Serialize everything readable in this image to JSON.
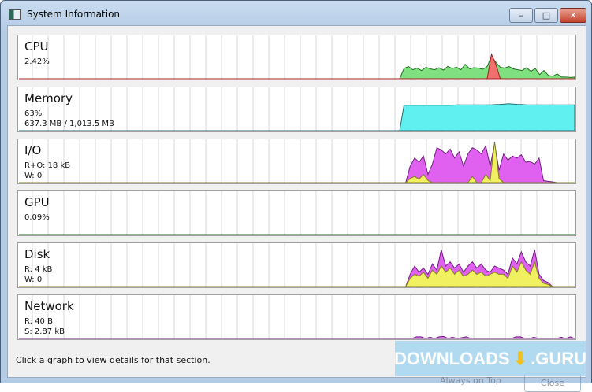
{
  "window": {
    "title": "System Information",
    "minimize": "–",
    "maximize": "□",
    "close": "✕"
  },
  "panels": [
    {
      "id": "cpu",
      "title": "CPU",
      "lines": [
        "2.42%"
      ],
      "series": [
        {
          "color": "#80e080",
          "stroke": "#207020",
          "values": [
            0,
            0,
            0,
            0,
            0,
            0,
            0,
            0,
            0,
            0,
            0,
            0,
            0,
            0,
            0,
            0,
            0,
            0,
            0,
            0,
            0,
            0,
            0,
            0,
            0,
            0,
            0,
            0,
            0,
            0,
            0,
            0,
            0,
            0,
            0,
            0,
            0,
            0,
            0,
            0,
            0,
            0,
            0,
            0,
            0,
            0,
            0,
            0,
            0,
            0,
            0,
            0,
            0,
            0,
            0,
            0,
            0,
            0,
            0,
            0,
            0,
            0,
            0,
            0,
            0,
            0,
            0,
            0,
            0,
            0,
            0,
            0,
            0,
            0,
            0,
            0,
            0,
            0,
            0,
            0,
            0,
            0,
            0,
            0,
            0,
            0,
            0,
            0,
            25,
            30,
            22,
            26,
            20,
            28,
            24,
            22,
            27,
            21,
            30,
            25,
            28,
            22,
            35,
            24,
            27,
            26,
            23,
            30,
            55,
            40,
            28,
            26,
            30,
            24,
            22,
            20,
            27,
            18,
            25,
            10,
            20,
            8,
            6,
            12,
            4,
            4,
            3,
            4
          ]
        },
        {
          "color": "#f07070",
          "stroke": "#a02020",
          "values": [
            0,
            0,
            0,
            0,
            0,
            0,
            0,
            0,
            0,
            0,
            0,
            0,
            0,
            0,
            0,
            0,
            0,
            0,
            0,
            0,
            0,
            0,
            0,
            0,
            0,
            0,
            0,
            0,
            0,
            0,
            0,
            0,
            0,
            0,
            0,
            0,
            0,
            0,
            0,
            0,
            0,
            0,
            0,
            0,
            0,
            0,
            0,
            0,
            0,
            0,
            0,
            0,
            0,
            0,
            0,
            0,
            0,
            0,
            0,
            0,
            0,
            0,
            0,
            0,
            0,
            0,
            0,
            0,
            0,
            0,
            0,
            0,
            0,
            0,
            0,
            0,
            0,
            0,
            0,
            0,
            0,
            0,
            0,
            0,
            0,
            0,
            0,
            0,
            0,
            0,
            0,
            0,
            0,
            0,
            0,
            0,
            0,
            0,
            0,
            0,
            0,
            0,
            0,
            0,
            0,
            0,
            0,
            0,
            60,
            35,
            0,
            0,
            0,
            0,
            0,
            0,
            0,
            0,
            0,
            0,
            0,
            0,
            0,
            0,
            0,
            0,
            0,
            0
          ]
        }
      ]
    },
    {
      "id": "memory",
      "title": "Memory",
      "lines": [
        "63%",
        "637.3 MB / 1,013.5 MB"
      ],
      "series": [
        {
          "color": "#60f0f0",
          "stroke": "#207070",
          "values": [
            0,
            0,
            0,
            0,
            0,
            0,
            0,
            0,
            0,
            0,
            0,
            0,
            0,
            0,
            0,
            0,
            0,
            0,
            0,
            0,
            0,
            0,
            0,
            0,
            0,
            0,
            0,
            0,
            0,
            0,
            0,
            0,
            0,
            0,
            0,
            0,
            0,
            0,
            0,
            0,
            0,
            0,
            0,
            0,
            0,
            0,
            0,
            0,
            0,
            0,
            0,
            0,
            0,
            0,
            0,
            0,
            0,
            0,
            0,
            0,
            0,
            0,
            0,
            0,
            0,
            0,
            0,
            0,
            0,
            0,
            0,
            0,
            0,
            0,
            0,
            0,
            0,
            0,
            0,
            0,
            0,
            0,
            0,
            0,
            0,
            0,
            0,
            0,
            62,
            62,
            62,
            62,
            62,
            62,
            62,
            62,
            62,
            62,
            62,
            62,
            63,
            63,
            63,
            63,
            63,
            63,
            63,
            63,
            63,
            64,
            64,
            65,
            66,
            65,
            64,
            64,
            63,
            63,
            63,
            63,
            63,
            63,
            63,
            63,
            63,
            63,
            63,
            63
          ]
        }
      ]
    },
    {
      "id": "io",
      "title": "I/O",
      "lines": [
        "R+O: 18 kB",
        "W: 0"
      ],
      "series": [
        {
          "color": "#e060f0",
          "stroke": "#702080",
          "values": [
            0,
            0,
            0,
            0,
            0,
            0,
            0,
            0,
            0,
            0,
            0,
            0,
            0,
            0,
            0,
            0,
            0,
            0,
            0,
            0,
            0,
            0,
            0,
            0,
            0,
            0,
            0,
            0,
            0,
            0,
            0,
            0,
            0,
            0,
            0,
            0,
            0,
            0,
            0,
            0,
            0,
            0,
            0,
            0,
            0,
            0,
            0,
            0,
            0,
            0,
            0,
            0,
            0,
            0,
            0,
            0,
            0,
            0,
            0,
            0,
            0,
            0,
            0,
            0,
            0,
            0,
            0,
            0,
            0,
            0,
            0,
            0,
            0,
            0,
            0,
            0,
            0,
            0,
            0,
            0,
            0,
            0,
            0,
            0,
            0,
            0,
            0,
            0,
            40,
            60,
            50,
            65,
            20,
            45,
            85,
            80,
            70,
            82,
            60,
            75,
            40,
            70,
            85,
            80,
            70,
            90,
            40,
            95,
            30,
            70,
            55,
            65,
            60,
            68,
            50,
            52,
            45,
            60,
            5,
            3,
            2,
            0,
            0,
            0,
            0,
            0
          ]
        },
        {
          "color": "#f0f060",
          "stroke": "#808020",
          "values": [
            0,
            0,
            0,
            0,
            0,
            0,
            0,
            0,
            0,
            0,
            0,
            0,
            0,
            0,
            0,
            0,
            0,
            0,
            0,
            0,
            0,
            0,
            0,
            0,
            0,
            0,
            0,
            0,
            0,
            0,
            0,
            0,
            0,
            0,
            0,
            0,
            0,
            0,
            0,
            0,
            0,
            0,
            0,
            0,
            0,
            0,
            0,
            0,
            0,
            0,
            0,
            0,
            0,
            0,
            0,
            0,
            0,
            0,
            0,
            0,
            0,
            0,
            0,
            0,
            0,
            0,
            0,
            0,
            0,
            0,
            0,
            0,
            0,
            0,
            0,
            0,
            0,
            0,
            0,
            0,
            0,
            0,
            0,
            0,
            0,
            0,
            0,
            0,
            10,
            15,
            8,
            20,
            5,
            0,
            0,
            0,
            0,
            0,
            0,
            0,
            0,
            0,
            15,
            0,
            0,
            20,
            5,
            100,
            10,
            0,
            0,
            0,
            0,
            0,
            0,
            0,
            0,
            0,
            0,
            0,
            0,
            0,
            0,
            0,
            0,
            0
          ]
        }
      ]
    },
    {
      "id": "gpu",
      "title": "GPU",
      "lines": [
        "0.09%"
      ],
      "series": [
        {
          "color": "#80e080",
          "stroke": "#207020",
          "values": [
            0,
            0
          ]
        }
      ]
    },
    {
      "id": "disk",
      "title": "Disk",
      "lines": [
        "R: 4 kB",
        "W: 0"
      ],
      "series": [
        {
          "color": "#e060f0",
          "stroke": "#702080",
          "values": [
            0,
            0,
            0,
            0,
            0,
            0,
            0,
            0,
            0,
            0,
            0,
            0,
            0,
            0,
            0,
            0,
            0,
            0,
            0,
            0,
            0,
            0,
            0,
            0,
            0,
            0,
            0,
            0,
            0,
            0,
            0,
            0,
            0,
            0,
            0,
            0,
            0,
            0,
            0,
            0,
            0,
            0,
            0,
            0,
            0,
            0,
            0,
            0,
            0,
            0,
            0,
            0,
            0,
            0,
            0,
            0,
            0,
            0,
            0,
            0,
            0,
            0,
            0,
            0,
            0,
            0,
            0,
            0,
            0,
            0,
            0,
            0,
            0,
            0,
            0,
            0,
            0,
            0,
            0,
            0,
            0,
            0,
            0,
            0,
            0,
            0,
            0,
            0,
            30,
            50,
            35,
            45,
            30,
            55,
            40,
            90,
            50,
            60,
            45,
            55,
            35,
            50,
            60,
            45,
            55,
            40,
            35,
            50,
            45,
            40,
            30,
            70,
            55,
            85,
            60,
            50,
            90,
            30,
            15,
            10,
            0,
            0,
            0,
            0,
            0,
            0
          ]
        },
        {
          "color": "#f0f060",
          "stroke": "#808020",
          "values": [
            0,
            0,
            0,
            0,
            0,
            0,
            0,
            0,
            0,
            0,
            0,
            0,
            0,
            0,
            0,
            0,
            0,
            0,
            0,
            0,
            0,
            0,
            0,
            0,
            0,
            0,
            0,
            0,
            0,
            0,
            0,
            0,
            0,
            0,
            0,
            0,
            0,
            0,
            0,
            0,
            0,
            0,
            0,
            0,
            0,
            0,
            0,
            0,
            0,
            0,
            0,
            0,
            0,
            0,
            0,
            0,
            0,
            0,
            0,
            0,
            0,
            0,
            0,
            0,
            0,
            0,
            0,
            0,
            0,
            0,
            0,
            0,
            0,
            0,
            0,
            0,
            0,
            0,
            0,
            0,
            0,
            0,
            0,
            0,
            0,
            0,
            0,
            0,
            20,
            30,
            25,
            35,
            20,
            40,
            30,
            50,
            35,
            45,
            30,
            40,
            25,
            30,
            40,
            30,
            35,
            25,
            30,
            35,
            30,
            30,
            20,
            50,
            35,
            60,
            40,
            30,
            60,
            20,
            8,
            5,
            0,
            0,
            0,
            0,
            0,
            0
          ]
        }
      ]
    },
    {
      "id": "network",
      "title": "Network",
      "lines": [
        "R: 40 B",
        "S: 2.87 kB"
      ],
      "series": [
        {
          "color": "#e060f0",
          "stroke": "#702080",
          "values": [
            0,
            0,
            0,
            0,
            0,
            0,
            0,
            0,
            0,
            0,
            0,
            0,
            0,
            0,
            0,
            0,
            0,
            0,
            0,
            0,
            0,
            0,
            0,
            0,
            0,
            0,
            0,
            0,
            0,
            0,
            0,
            0,
            0,
            0,
            0,
            0,
            0,
            0,
            0,
            0,
            0,
            0,
            0,
            0,
            0,
            0,
            0,
            0,
            0,
            0,
            0,
            0,
            0,
            0,
            0,
            0,
            0,
            0,
            0,
            0,
            0,
            0,
            0,
            0,
            0,
            0,
            0,
            0,
            0,
            0,
            0,
            0,
            0,
            0,
            0,
            0,
            0,
            0,
            0,
            0,
            0,
            0,
            0,
            0,
            0,
            0,
            0,
            0,
            4,
            4,
            0,
            3,
            0,
            4,
            5,
            0,
            3,
            0,
            2,
            4,
            0,
            0,
            0,
            0,
            0,
            0,
            0,
            0,
            0,
            0,
            4,
            4,
            0,
            0,
            3,
            0,
            0,
            0,
            0,
            0,
            3,
            0,
            4,
            0
          ]
        }
      ]
    }
  ],
  "status": "Click a graph to view details for that section.",
  "always_on_top": "Always on Top",
  "close_button": "Close",
  "watermark": "DOWNLOADS GURU"
}
